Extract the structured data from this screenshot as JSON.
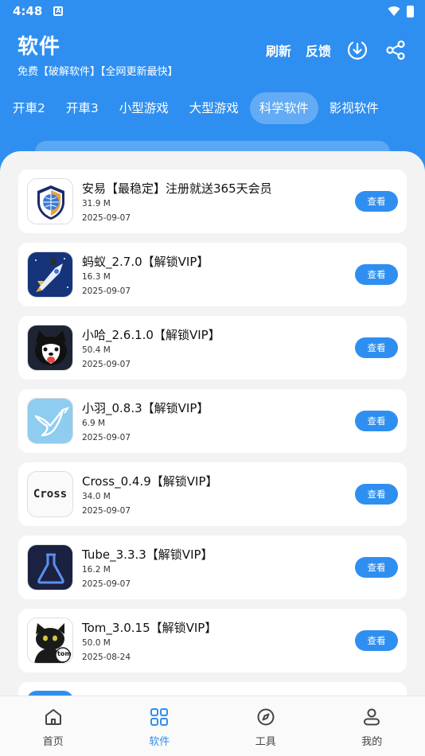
{
  "status": {
    "time": "4:48",
    "notification": "A"
  },
  "header": {
    "title": "软件",
    "subtitle": "免费【破解软件】【全网更新最快】",
    "refresh": "刷新",
    "feedback": "反馈"
  },
  "tabs": [
    {
      "label": "开車2",
      "active": false
    },
    {
      "label": "开車3",
      "active": false
    },
    {
      "label": "小型游戏",
      "active": false
    },
    {
      "label": "大型游戏",
      "active": false
    },
    {
      "label": "科学软件",
      "active": true
    },
    {
      "label": "影视软件",
      "active": false
    }
  ],
  "apps": [
    {
      "name": "安易【最稳定】注册就送365天会员",
      "size": "31.9 M",
      "date": "2025-09-07",
      "button": "查看",
      "icon": "shield-globe-icon"
    },
    {
      "name": "蚂蚁_2.7.0【解锁VIP】",
      "size": "16.3 M",
      "date": "2025-09-07",
      "button": "查看",
      "icon": "rocket-ant-icon"
    },
    {
      "name": "小哈_2.6.1.0【解锁VIP】",
      "size": "50.4 M",
      "date": "2025-09-07",
      "button": "查看",
      "icon": "husky-icon"
    },
    {
      "name": "小羽_0.8.3【解锁VIP】",
      "size": "6.9 M",
      "date": "2025-09-07",
      "button": "查看",
      "icon": "bird-icon"
    },
    {
      "name": "Cross_0.4.9【解锁VIP】",
      "size": "34.0 M",
      "date": "2025-09-07",
      "button": "查看",
      "icon": "cross-text-icon",
      "icon_text": "Cross"
    },
    {
      "name": "Tube_3.3.3【解锁VIP】",
      "size": "16.2 M",
      "date": "2025-09-07",
      "button": "查看",
      "icon": "flask-icon"
    },
    {
      "name": "Tom_3.0.15【解锁VIP】",
      "size": "50.0 M",
      "date": "2025-08-24",
      "button": "查看",
      "icon": "black-cat-icon",
      "icon_text": "tom"
    }
  ],
  "nav": [
    {
      "label": "首页",
      "icon": "home-icon",
      "active": false
    },
    {
      "label": "软件",
      "icon": "grid-icon",
      "active": true
    },
    {
      "label": "工具",
      "icon": "compass-icon",
      "active": false
    },
    {
      "label": "我的",
      "icon": "user-icon",
      "active": false
    }
  ],
  "colors": {
    "primary": "#2f8ff0",
    "background": "#f3f3f3",
    "card": "#ffffff"
  }
}
